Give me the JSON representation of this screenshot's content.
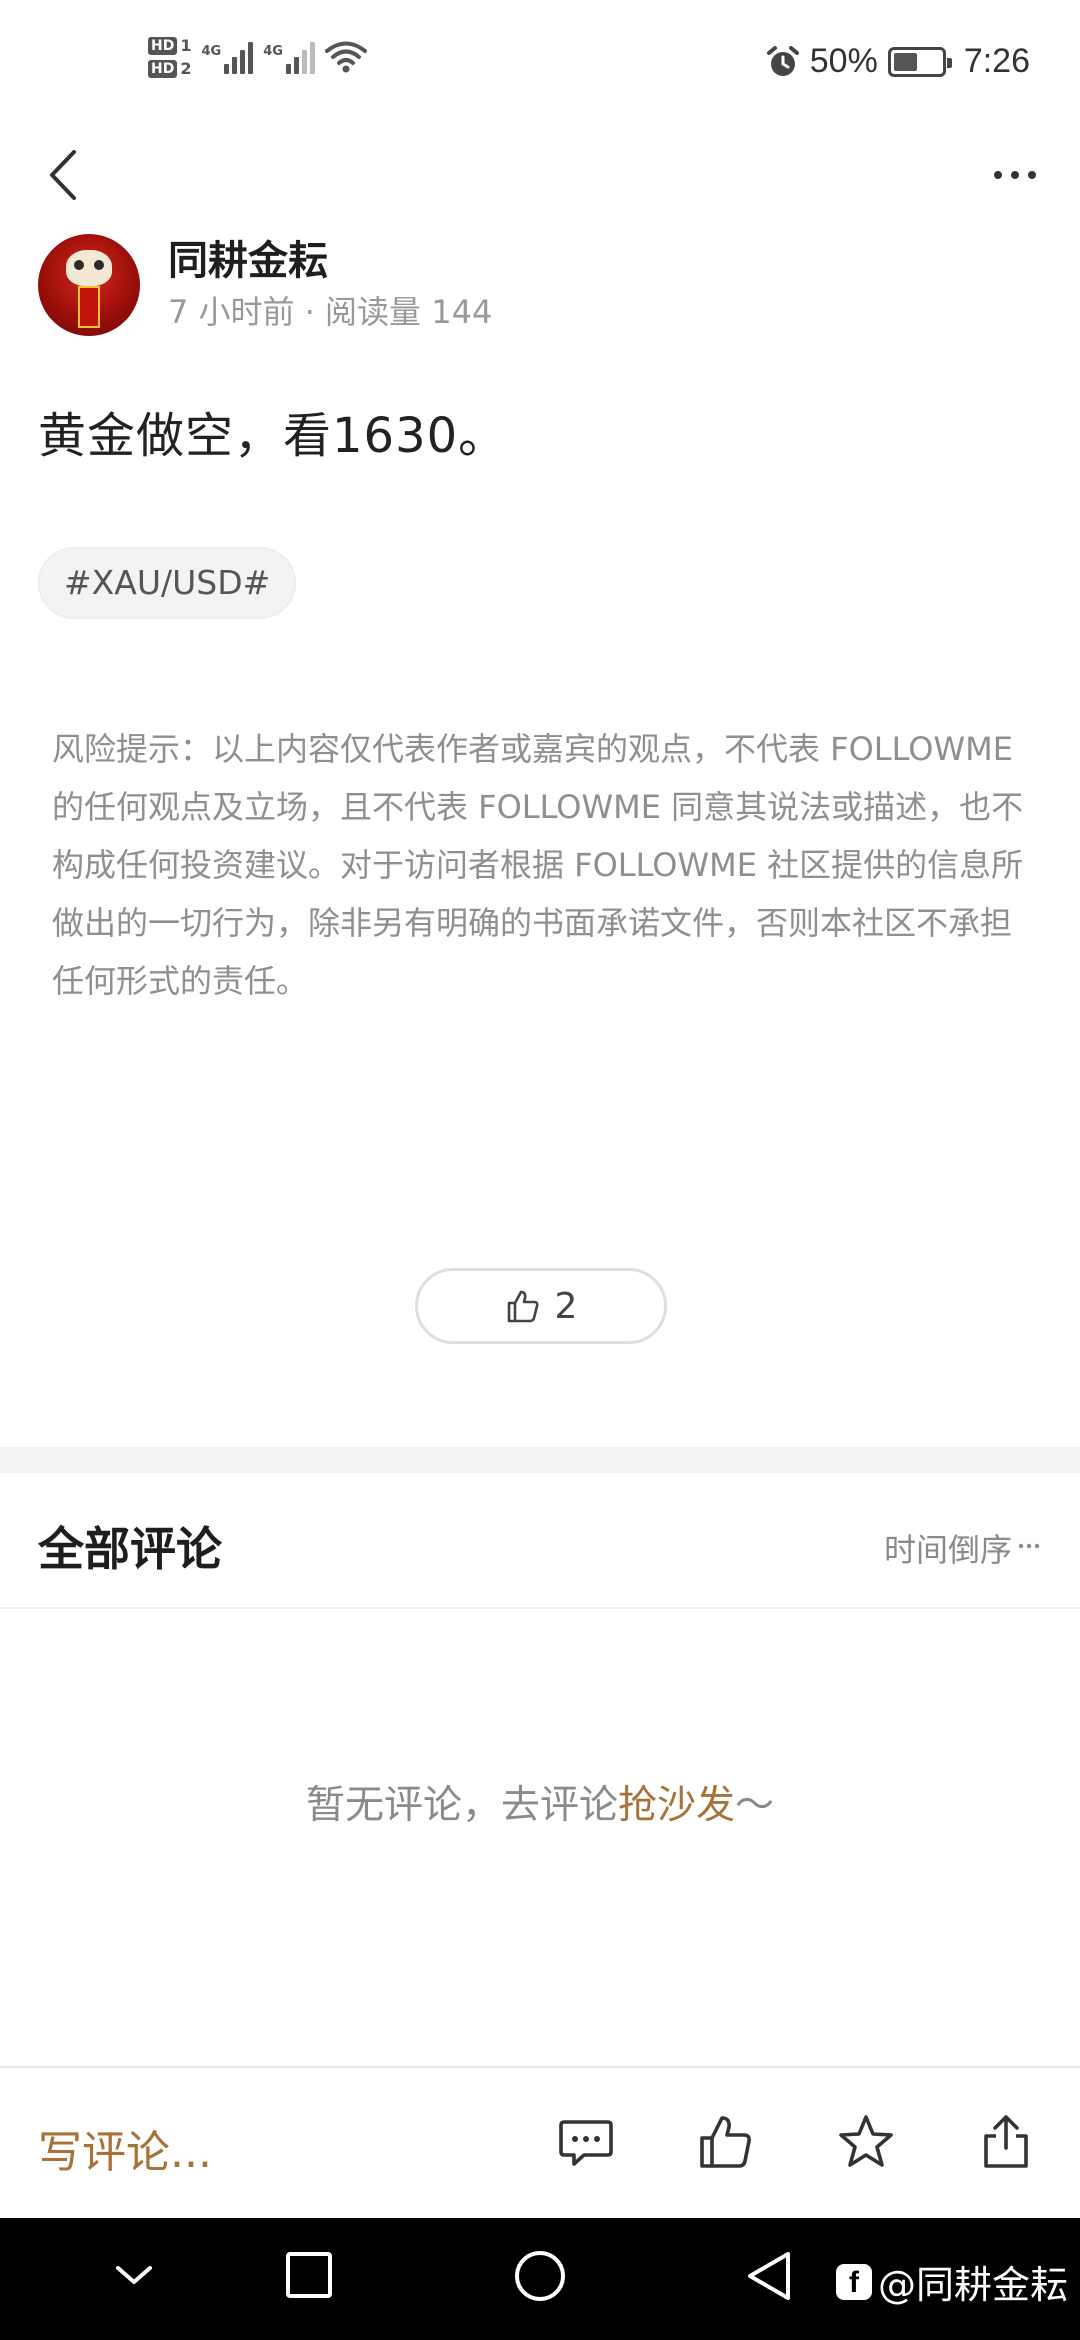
{
  "status_bar": {
    "sim1": "HD",
    "sim1_num": "1",
    "sim2": "HD",
    "sim2_num": "2",
    "network1": "4G",
    "network2": "4G",
    "battery_percent": "50%",
    "battery_level": 0.5,
    "time": "7:26"
  },
  "author": {
    "name": "同耕金耘",
    "meta": "7 小时前 · 阅读量 144"
  },
  "post": {
    "text": "黄金做空，看1630。",
    "tag": "#XAU/USD#",
    "disclaimer": "风险提示：以上内容仅代表作者或嘉宾的观点，不代表 FOLLOWME 的任何观点及立场，且不代表 FOLLOWME 同意其说法或描述，也不构成任何投资建议。对于访问者根据 FOLLOWME 社区提供的信息所做出的一切行为，除非另有明确的书面承诺文件，否则本社区不承担任何形式的责任。",
    "like_count": "2"
  },
  "comments": {
    "title": "全部评论",
    "sort_label": "时间倒序",
    "empty_prefix": "暂无评论，去评论",
    "empty_link": "抢沙发",
    "empty_suffix": "～"
  },
  "action_bar": {
    "write_placeholder": "写评论..."
  },
  "watermark": {
    "logo": "f",
    "text": "@同耕金耘"
  },
  "icons": {
    "back": "chevron-left-icon",
    "more": "more-dots-icon",
    "like": "thumbs-up-icon",
    "comment": "comment-icon",
    "favorite": "star-icon",
    "share": "share-icon"
  },
  "colors": {
    "accent": "#a97239",
    "muted_text": "#8f8f8f",
    "band": "#f2f2f2"
  }
}
